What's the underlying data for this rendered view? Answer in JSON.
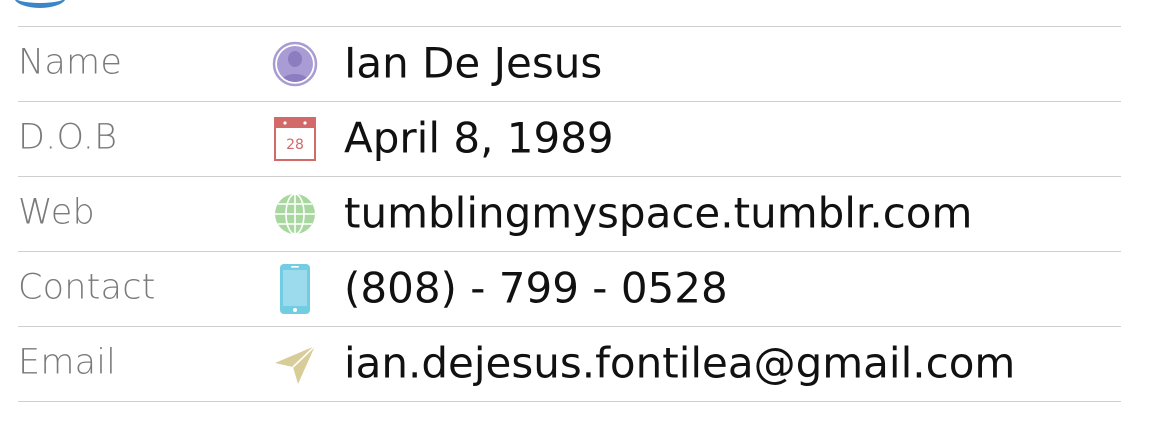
{
  "profile": {
    "rows": [
      {
        "label": "Name",
        "value": "Ian De Jesus",
        "icon": "person-icon",
        "icon_color": "#a99bd4"
      },
      {
        "label": "D.O.B",
        "value": "April 8, 1989",
        "icon": "calendar-icon",
        "icon_color": "#d26a6a",
        "icon_text": "28"
      },
      {
        "label": "Web",
        "value": "tumblingmyspace.tumblr.com",
        "icon": "globe-icon",
        "icon_color": "#a8d8a0"
      },
      {
        "label": "Contact",
        "value": "(808) - 799 - 0528",
        "icon": "phone-icon",
        "icon_color": "#72cce2"
      },
      {
        "label": "Email",
        "value": "ian.dejesus.fontilea@gmail.com",
        "icon": "paper-plane-icon",
        "icon_color": "#d8cc98"
      }
    ]
  }
}
